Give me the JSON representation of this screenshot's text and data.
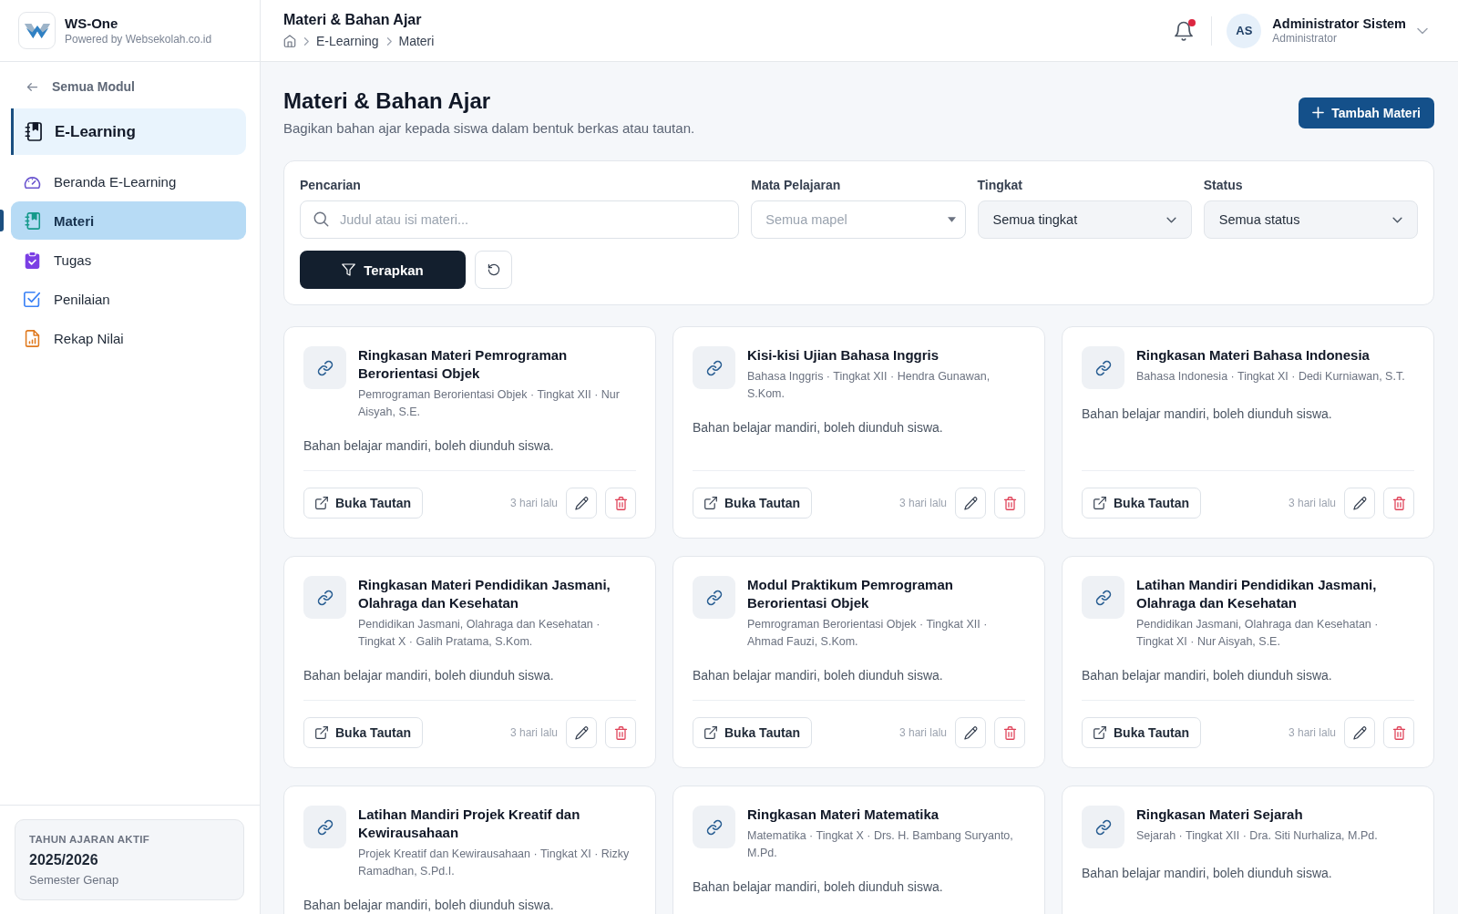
{
  "app": {
    "name": "WS-One",
    "tagline": "Powered by Websekolah.co.id"
  },
  "sidebar": {
    "back_link": "Semua Modul",
    "module": "E-Learning",
    "items": [
      {
        "kind": "dashboard",
        "label": "Beranda E-Learning",
        "selected": false
      },
      {
        "kind": "materials",
        "label": "Materi",
        "selected": true
      },
      {
        "kind": "assignments",
        "label": "Tugas",
        "selected": false
      },
      {
        "kind": "grading",
        "label": "Penilaian",
        "selected": false
      },
      {
        "kind": "report",
        "label": "Rekap Nilai",
        "selected": false
      }
    ],
    "academic_year": {
      "heading": "TAHUN AJARAN AKTIF",
      "year": "2025/2026",
      "semester": "Semester Genap"
    }
  },
  "header": {
    "title": "Materi & Bahan Ajar",
    "breadcrumb": [
      "E-Learning",
      "Materi"
    ],
    "notifications": {
      "unread": true
    },
    "user": {
      "initials": "AS",
      "name": "Administrator Sistem",
      "role": "Administrator"
    }
  },
  "page": {
    "title": "Materi & Bahan Ajar",
    "subtitle": "Bagikan bahan ajar kepada siswa dalam bentuk berkas atau tautan.",
    "add_button": "Tambah Materi"
  },
  "filters": {
    "fields": [
      {
        "kind": "search",
        "label": "Pencarian",
        "placeholder": "Judul atau isi materi..."
      },
      {
        "kind": "picker",
        "label": "Mata Pelajaran",
        "placeholder": "Semua mapel"
      },
      {
        "kind": "select",
        "label": "Tingkat",
        "value": "Semua tingkat"
      },
      {
        "kind": "select",
        "label": "Status",
        "value": "Semua status"
      }
    ],
    "apply_button": "Terapkan"
  },
  "materials": [
    {
      "title": "Ringkasan Materi Pemrograman Berorientasi Objek",
      "meta": "Pemrograman Berorientasi Objek · Tingkat XII · Nur Aisyah, S.E.",
      "description": "Bahan belajar mandiri, boleh diunduh siswa.",
      "open_button": "Buka Tautan",
      "time": "3 hari lalu"
    },
    {
      "title": "Kisi-kisi Ujian Bahasa Inggris",
      "meta": "Bahasa Inggris · Tingkat XII · Hendra Gunawan, S.Kom.",
      "description": "Bahan belajar mandiri, boleh diunduh siswa.",
      "open_button": "Buka Tautan",
      "time": "3 hari lalu"
    },
    {
      "title": "Ringkasan Materi Bahasa Indonesia",
      "meta": "Bahasa Indonesia · Tingkat XI · Dedi Kurniawan, S.T.",
      "description": "Bahan belajar mandiri, boleh diunduh siswa.",
      "open_button": "Buka Tautan",
      "time": "3 hari lalu"
    },
    {
      "title": "Ringkasan Materi Pendidikan Jasmani, Olahraga dan Kesehatan",
      "meta": "Pendidikan Jasmani, Olahraga dan Kesehatan · Tingkat X · Galih Pratama, S.Kom.",
      "description": "Bahan belajar mandiri, boleh diunduh siswa.",
      "open_button": "Buka Tautan",
      "time": "3 hari lalu"
    },
    {
      "title": "Modul Praktikum Pemrograman Berorientasi Objek",
      "meta": "Pemrograman Berorientasi Objek · Tingkat XII · Ahmad Fauzi, S.Kom.",
      "description": "Bahan belajar mandiri, boleh diunduh siswa.",
      "open_button": "Buka Tautan",
      "time": "3 hari lalu"
    },
    {
      "title": "Latihan Mandiri Pendidikan Jasmani, Olahraga dan Kesehatan",
      "meta": "Pendidikan Jasmani, Olahraga dan Kesehatan · Tingkat XI · Nur Aisyah, S.E.",
      "description": "Bahan belajar mandiri, boleh diunduh siswa.",
      "open_button": "Buka Tautan",
      "time": "3 hari lalu"
    },
    {
      "title": "Latihan Mandiri Projek Kreatif dan Kewirausahaan",
      "meta": "Projek Kreatif dan Kewirausahaan · Tingkat XI · Rizky Ramadhan, S.Pd.I.",
      "description": "Bahan belajar mandiri, boleh diunduh siswa."
    },
    {
      "title": "Ringkasan Materi Matematika",
      "meta": "Matematika · Tingkat X · Drs. H. Bambang Suryanto, M.Pd.",
      "description": "Bahan belajar mandiri, boleh diunduh siswa."
    },
    {
      "title": "Ringkasan Materi Sejarah",
      "meta": "Sejarah · Tingkat XII · Dra. Siti Nurhaliza, M.Pd.",
      "description": "Bahan belajar mandiri, boleh diunduh siswa."
    }
  ]
}
